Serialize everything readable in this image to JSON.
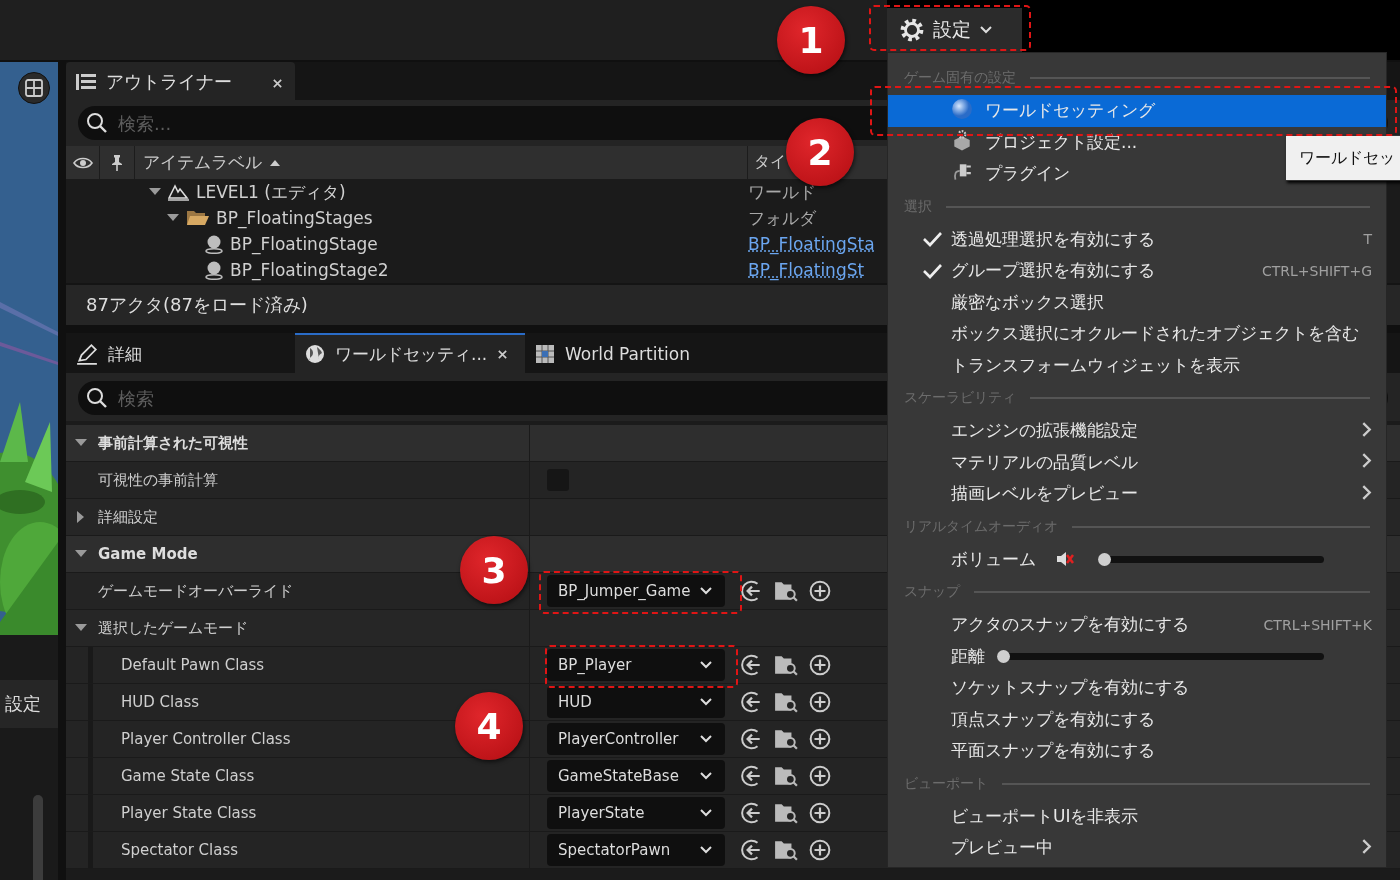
{
  "toolbar": {
    "settings_button": {
      "label": "設定"
    }
  },
  "side_panel": {
    "tab": {
      "label": "設定"
    }
  },
  "outliner": {
    "tab": {
      "label": "アウトライナー"
    },
    "search": {
      "placeholder": "検索..."
    },
    "columns": [
      "アイテムラベル",
      "タイ"
    ],
    "tree": [
      {
        "kind": "world",
        "label": "LEVEL1 (エディタ)",
        "type": "ワールド",
        "expanded": true,
        "children": [
          {
            "kind": "folder",
            "label": "BP_FloatingStages",
            "type": "フォルダ",
            "expanded": true,
            "children": [
              {
                "kind": "actor",
                "label": "BP_FloatingStage",
                "type": "BP_FloatingSta"
              },
              {
                "kind": "actor",
                "label": "BP_FloatingStage2",
                "type": "BP_FloatingSt"
              }
            ]
          }
        ]
      }
    ],
    "status": "87アクタ(87をロード済み)"
  },
  "details": {
    "tabs": [
      {
        "kind": "details",
        "label": "詳細",
        "selected": false
      },
      {
        "kind": "world",
        "label": "ワールドセッティ...",
        "selected": true
      },
      {
        "kind": "partition",
        "label": "World Partition",
        "selected": false
      }
    ],
    "search": {
      "placeholder": "検索"
    },
    "properties": [
      {
        "kind": "group",
        "label": "事前計算された可視性",
        "expanded": true,
        "children": [
          {
            "kind": "checkbox",
            "label": "可視性の事前計算",
            "checked": false
          },
          {
            "kind": "subgroup",
            "label": "詳細設定",
            "expanded": false
          }
        ]
      },
      {
        "kind": "group",
        "label": "Game Mode",
        "expanded": true,
        "children": [
          {
            "kind": "dropdown",
            "label": "ゲームモードオーバーライド",
            "value": "BP_Jumper_Game"
          },
          {
            "kind": "subgroup",
            "label": "選択したゲームモード",
            "expanded": true,
            "children": [
              {
                "kind": "dropdown",
                "label": "Default Pawn Class",
                "value": "BP_Player"
              },
              {
                "kind": "dropdown",
                "label": "HUD Class",
                "value": "HUD"
              },
              {
                "kind": "dropdown",
                "label": "Player Controller Class",
                "value": "PlayerController"
              },
              {
                "kind": "dropdown",
                "label": "Game State Class",
                "value": "GameStateBase"
              },
              {
                "kind": "dropdown",
                "label": "Player State Class",
                "value": "PlayerState"
              },
              {
                "kind": "dropdown",
                "label": "Spectator Class",
                "value": "SpectatorPawn"
              }
            ]
          }
        ]
      }
    ]
  },
  "menu": {
    "sections": [
      {
        "heading": "ゲーム固有の設定",
        "items": [
          {
            "kind": "command",
            "label": "ワールドセッティング",
            "selected": true
          },
          {
            "kind": "command",
            "label": "プロジェクト設定...",
            "selected": false
          },
          {
            "kind": "command",
            "label": "プラグイン",
            "selected": false
          }
        ]
      },
      {
        "heading": "選択",
        "items": [
          {
            "kind": "toggle",
            "label": "透過処理選択を有効にする",
            "checked": true,
            "shortcut": "T",
            "selected": false
          },
          {
            "kind": "toggle",
            "label": "グループ選択を有効にする",
            "checked": true,
            "shortcut": "CTRL+SHIFT+G",
            "selected": false
          },
          {
            "kind": "toggle",
            "label": "厳密なボックス選択",
            "checked": false,
            "selected": false
          },
          {
            "kind": "toggle",
            "label": "ボックス選択にオクルードされたオブジェクトを含む",
            "checked": false,
            "selected": false
          },
          {
            "kind": "toggle",
            "label": "トランスフォームウィジェットを表示",
            "checked": false,
            "selected": false
          }
        ]
      },
      {
        "heading": "スケーラビリティ",
        "items": [
          {
            "kind": "submenu",
            "label": "エンジンの拡張機能設定",
            "selected": false
          },
          {
            "kind": "submenu",
            "label": "マテリアルの品質レベル",
            "selected": false
          },
          {
            "kind": "submenu",
            "label": "描画レベルをプレビュー",
            "selected": false
          }
        ]
      },
      {
        "heading": "リアルタイムオーディオ",
        "items": [
          {
            "kind": "volume",
            "label": "ボリューム",
            "level": 0,
            "selected": false
          }
        ]
      },
      {
        "heading": "スナップ",
        "items": [
          {
            "kind": "toggle",
            "label": "アクタのスナップを有効にする",
            "checked": false,
            "shortcut": "CTRL+SHIFT+K",
            "selected": false
          },
          {
            "kind": "slider",
            "label": "距離",
            "level": 0,
            "selected": false
          },
          {
            "kind": "toggle",
            "label": "ソケットスナップを有効にする",
            "checked": false,
            "selected": false
          },
          {
            "kind": "toggle",
            "label": "頂点スナップを有効にする",
            "checked": false,
            "selected": false
          },
          {
            "kind": "toggle",
            "label": "平面スナップを有効にする",
            "checked": false,
            "selected": false
          }
        ]
      },
      {
        "heading": "ビューポート",
        "items": [
          {
            "kind": "toggle",
            "label": "ビューポートUIを非表示",
            "checked": false,
            "selected": false
          },
          {
            "kind": "submenu",
            "label": "プレビュー中",
            "selected": false
          }
        ]
      }
    ]
  },
  "tooltip": {
    "text": "ワールドセッ"
  },
  "markers": [
    "1",
    "2",
    "3",
    "4"
  ]
}
